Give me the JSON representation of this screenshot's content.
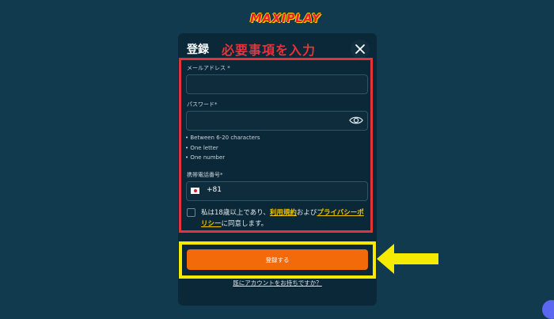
{
  "brand": {
    "logo_text": "MAXIPLAY"
  },
  "modal": {
    "title": "登録",
    "annotation": "必要事項を入力",
    "close_icon": "close-icon"
  },
  "form": {
    "email_label": "メールアドレス *",
    "email_value": "",
    "password_label": "パスワード*",
    "password_value": "",
    "password_rules": [
      "Between 6-20 characters",
      "One letter",
      "One number"
    ],
    "phone_label": "携帯電話番号*",
    "phone_code": "+81",
    "phone_value": "",
    "consent_prefix": "私は18歳以上であり、",
    "terms_link": "利用規約",
    "consent_middle": "および",
    "privacy_link": "プライバシーポリシー",
    "consent_suffix": "に同意します。"
  },
  "submit_label": "登録する",
  "login_link": "既にアカウントをお持ちですか？",
  "colors": {
    "background": "#123a4e",
    "modal": "#0b2838",
    "primary_button": "#f26a0a",
    "highlight_red": "#e53437",
    "highlight_yellow": "#f5ea00",
    "link": "#f2c200"
  }
}
